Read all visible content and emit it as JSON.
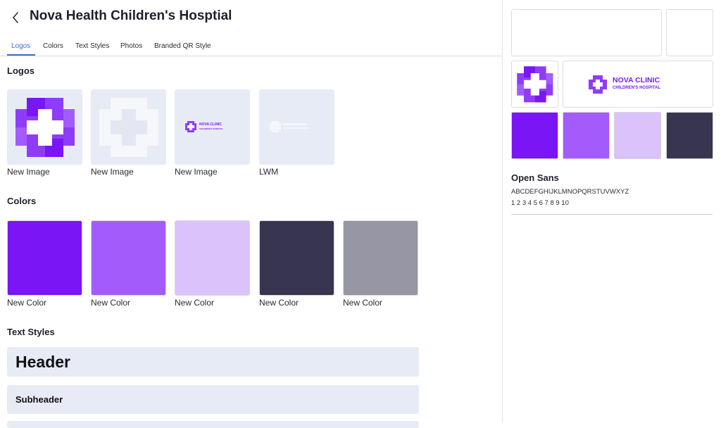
{
  "header": {
    "title": "Nova Health Children's Hosptial",
    "back_icon": "chevron-left-icon"
  },
  "tabs": [
    {
      "label": "Logos",
      "active": true
    },
    {
      "label": "Colors",
      "active": false
    },
    {
      "label": "Text Styles",
      "active": false
    },
    {
      "label": "Photos",
      "active": false
    },
    {
      "label": "Branded QR Style",
      "active": false
    }
  ],
  "logos": {
    "title": "Logos",
    "items": [
      {
        "caption": "New Image",
        "kind": "purple-cross-icon"
      },
      {
        "caption": "New Image",
        "kind": "white-cross-icon"
      },
      {
        "caption": "New Image",
        "kind": "nova-clinic-wordmark"
      },
      {
        "caption": "LWM",
        "kind": "white-wordmark"
      }
    ],
    "wordmark": {
      "title": "NOVA CLINIC",
      "subtitle": "CHILDREN'S HOSPITAL"
    }
  },
  "colors": {
    "title": "Colors",
    "items": [
      {
        "caption": "New Color",
        "hex": "#7a15f5"
      },
      {
        "caption": "New Color",
        "hex": "#a35cfb"
      },
      {
        "caption": "New Color",
        "hex": "#dbc2fb"
      },
      {
        "caption": "New Color",
        "hex": "#37354f"
      },
      {
        "caption": "New Color",
        "hex": "#9696a4"
      }
    ]
  },
  "text_styles": {
    "title": "Text Styles",
    "items": [
      {
        "label": "Header"
      },
      {
        "label": "Subheader"
      }
    ]
  },
  "preview": {
    "wordmark": {
      "title": "NOVA CLINIC",
      "subtitle": "CHILDREN'S HOSPITAL"
    },
    "swatches": [
      "#7a15f5",
      "#a35cfb",
      "#dbc2fb",
      "#37354f"
    ],
    "font": {
      "name": "Open Sans",
      "letters": "ABCDEFGHIJKLMNOPQRSTUVWXYZ",
      "digits": "1 2 3 4 5 6 7 8 9 10"
    }
  },
  "accent_color": "#3b6fd1"
}
